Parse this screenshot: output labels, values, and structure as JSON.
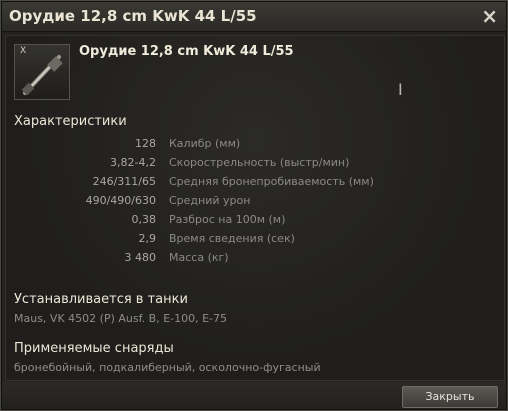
{
  "window": {
    "title": "Орудие 12,8 cm KwK 44 L/55",
    "close_icon": "×"
  },
  "item": {
    "tier": "X",
    "name": "Орудие 12,8 cm KwK 44 L/55",
    "icon": "gun-icon"
  },
  "characteristics": {
    "title": "Характеристики",
    "rows": [
      {
        "value": "128",
        "label": "Калибр (мм)"
      },
      {
        "value": "3,82-4,2",
        "label": "Скорострельность (выстр/мин)"
      },
      {
        "value": "246/311/65",
        "label": "Средняя бронепробиваемость (мм)"
      },
      {
        "value": "490/490/630",
        "label": "Средний урон"
      },
      {
        "value": "0,38",
        "label": "Разброс на 100м (м)"
      },
      {
        "value": "2,9",
        "label": "Время сведения (сек)"
      },
      {
        "value": "3 480",
        "label": "Масса (кг)"
      }
    ]
  },
  "tanks": {
    "title": "Устанавливается в танки",
    "text": "Maus, VK 4502 (P) Ausf. B, E-100, E-75"
  },
  "shells": {
    "title": "Применяемые снаряды",
    "text": "бронебойный, подкалиберный, осколочно-фугасный"
  },
  "footer": {
    "close_label": "Закрыть"
  }
}
